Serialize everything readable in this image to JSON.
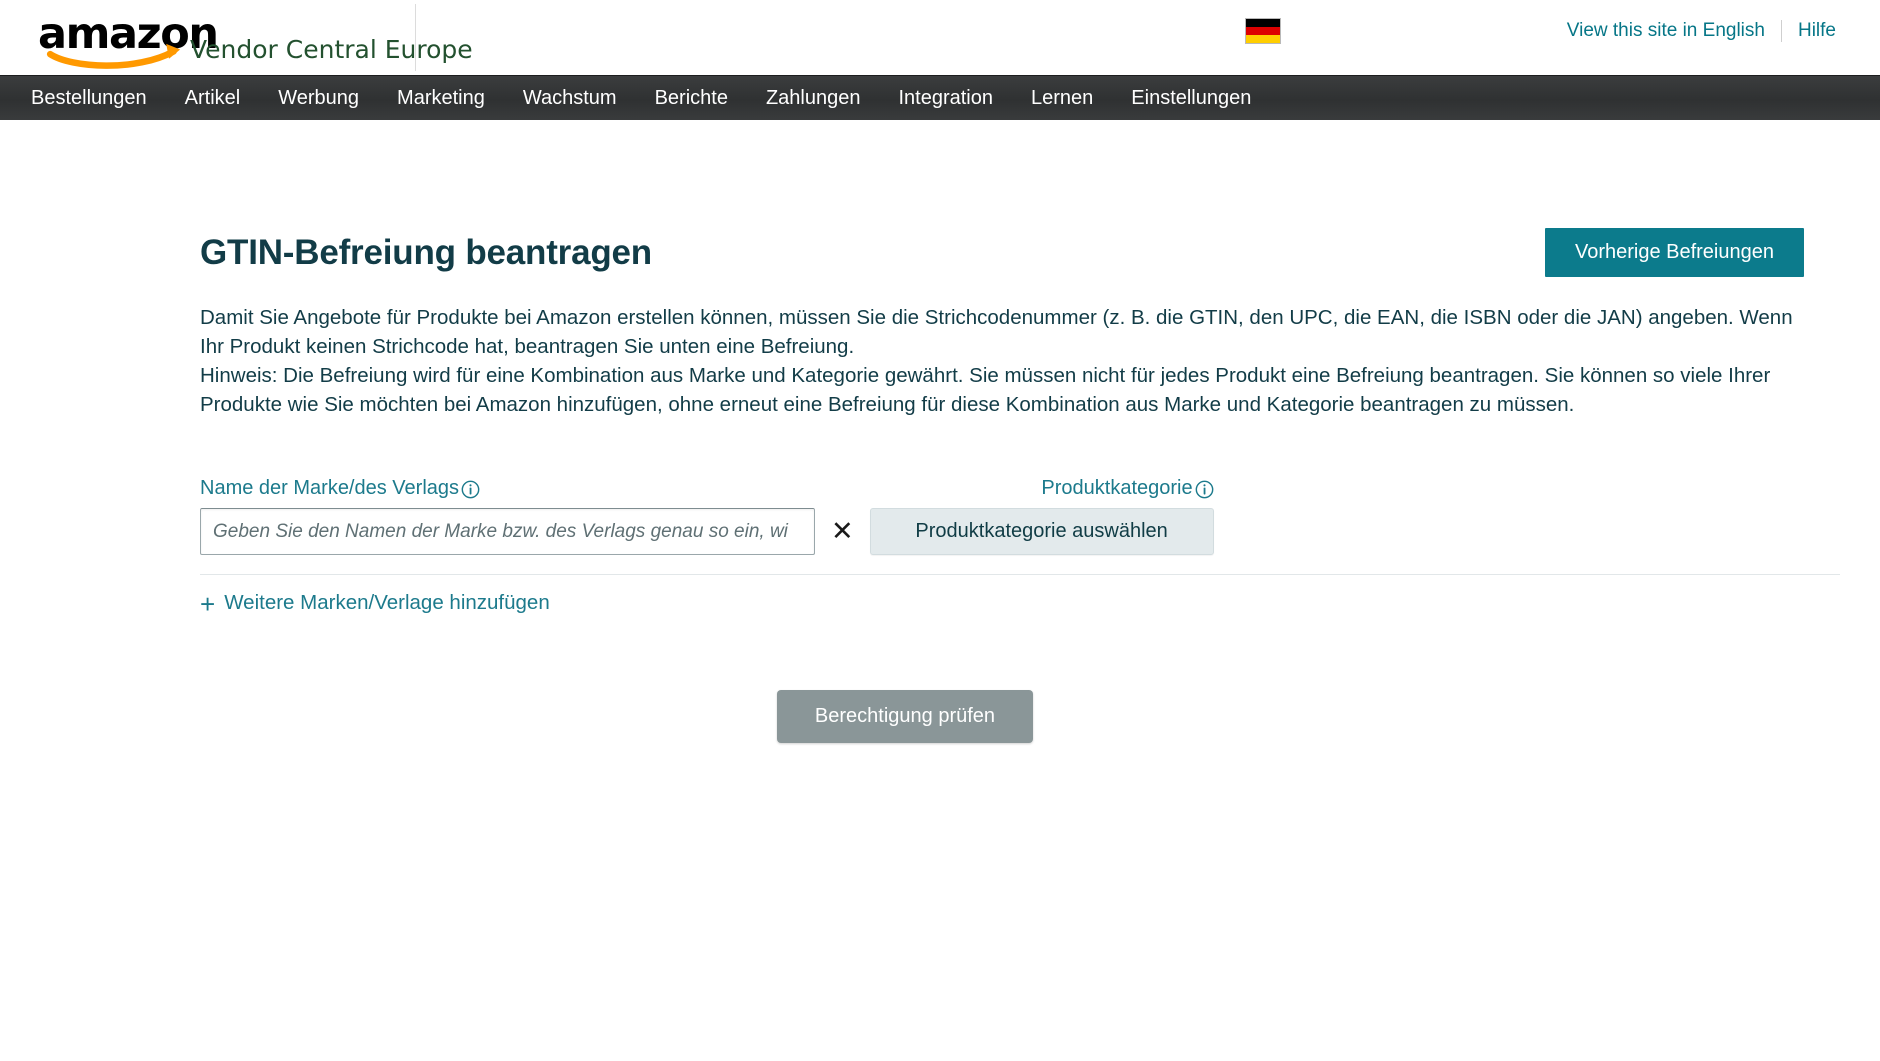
{
  "header": {
    "logo": {
      "wordmark": "amazon",
      "subtitle": "Vendor Central Europe",
      "swoosh_color": "#f90",
      "subtitle_color": "#23512f"
    },
    "locale_flag": "germany-flag",
    "links": [
      {
        "label": "View this site in English",
        "name": "view-in-english-link"
      },
      {
        "label": "Hilfe",
        "name": "help-link"
      }
    ],
    "link_color": "#067687"
  },
  "nav": {
    "background": "#2f3132",
    "items": [
      {
        "label": "Bestellungen",
        "name": "nav-item-bestellungen"
      },
      {
        "label": "Artikel",
        "name": "nav-item-artikel"
      },
      {
        "label": "Werbung",
        "name": "nav-item-werbung"
      },
      {
        "label": "Marketing",
        "name": "nav-item-marketing"
      },
      {
        "label": "Wachstum",
        "name": "nav-item-wachstum"
      },
      {
        "label": "Berichte",
        "name": "nav-item-berichte"
      },
      {
        "label": "Zahlungen",
        "name": "nav-item-zahlungen"
      },
      {
        "label": "Integration",
        "name": "nav-item-integration"
      },
      {
        "label": "Lernen",
        "name": "nav-item-lernen"
      },
      {
        "label": "Einstellungen",
        "name": "nav-item-einstellungen"
      }
    ]
  },
  "page": {
    "title": "GTIN-Befreiung beantragen",
    "title_color": "#123c47",
    "previous_exemptions_button": "Vorherige Befreiungen",
    "previous_exemptions_color": "#0c7b8c",
    "intro_paragraph_1": "Damit Sie Angebote für Produkte bei Amazon erstellen können, müssen Sie die Strichcodenummer (z. B. die GTIN, den UPC, die EAN, die ISBN oder die JAN) angeben. Wenn Ihr Produkt keinen Strichcode hat, beantragen Sie unten eine Befreiung.",
    "intro_paragraph_2": "Hinweis: Die Befreiung wird für eine Kombination aus Marke und Kategorie gewährt. Sie müssen nicht für jedes Produkt eine Befreiung beantragen. Sie können so viele Ihrer Produkte wie Sie möchten bei Amazon hinzufügen, ohne erneut eine Befreiung für diese Kombination aus Marke und Kategorie beantragen zu müssen."
  },
  "form": {
    "brand": {
      "label": "Name der Marke/des Verlags",
      "info_icon": "info-circle-icon",
      "value": "",
      "placeholder": "Geben Sie den Namen der Marke bzw. des Verlags genau so ein, wi"
    },
    "remove_row_icon": "close-x-icon",
    "category": {
      "label": "Produktkategorie",
      "info_icon": "info-circle-icon",
      "button_label": "Produktkategorie auswählen"
    },
    "add_more": {
      "icon": "plus-icon",
      "label": "Weitere Marken/Verlage hinzufügen"
    },
    "submit_label": "Berechtigung prüfen",
    "submit_color": "#8a9698",
    "label_color": "#1c7a8c"
  }
}
